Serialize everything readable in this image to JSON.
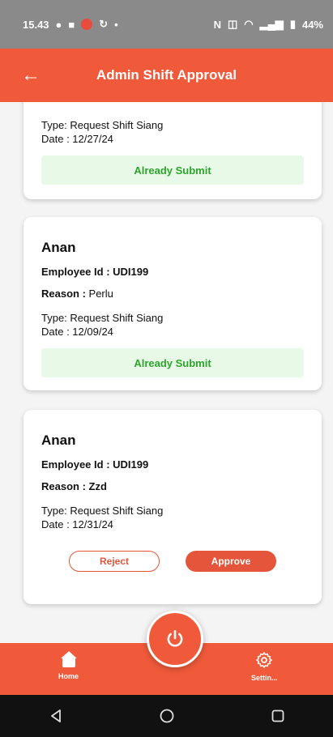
{
  "status_bar": {
    "time": "15.43",
    "battery": "44%"
  },
  "header": {
    "title": "Admin Shift Approval",
    "back_icon": "back-arrow-icon"
  },
  "cards": [
    {
      "type_line": "Type: Request Shift Siang",
      "date_line": "Date : 12/27/24",
      "status": "Already Submit"
    },
    {
      "name": "Anan",
      "employee_label": "Employee Id :",
      "employee_id": "UDI199",
      "reason_label": "Reason :",
      "reason": "Perlu",
      "type_line": "Type: Request Shift Siang",
      "date_line": "Date : 12/09/24",
      "status": "Already Submit"
    },
    {
      "name": "Anan",
      "employee_label": "Employee Id :",
      "employee_id": "UDI199",
      "reason_label": "Reason :",
      "reason": "Zzd",
      "type_line": "Type: Request Shift Siang",
      "date_line": "Date : 12/31/24",
      "reject_label": "Reject",
      "approve_label": "Approve"
    }
  ],
  "bottom_nav": {
    "home_label": "Home",
    "settings_label": "Settin...",
    "center_icon": "power-icon"
  },
  "colors": {
    "primary": "#f05a3a",
    "success_text": "#2ca52c",
    "success_bg": "#e8f9e8"
  }
}
